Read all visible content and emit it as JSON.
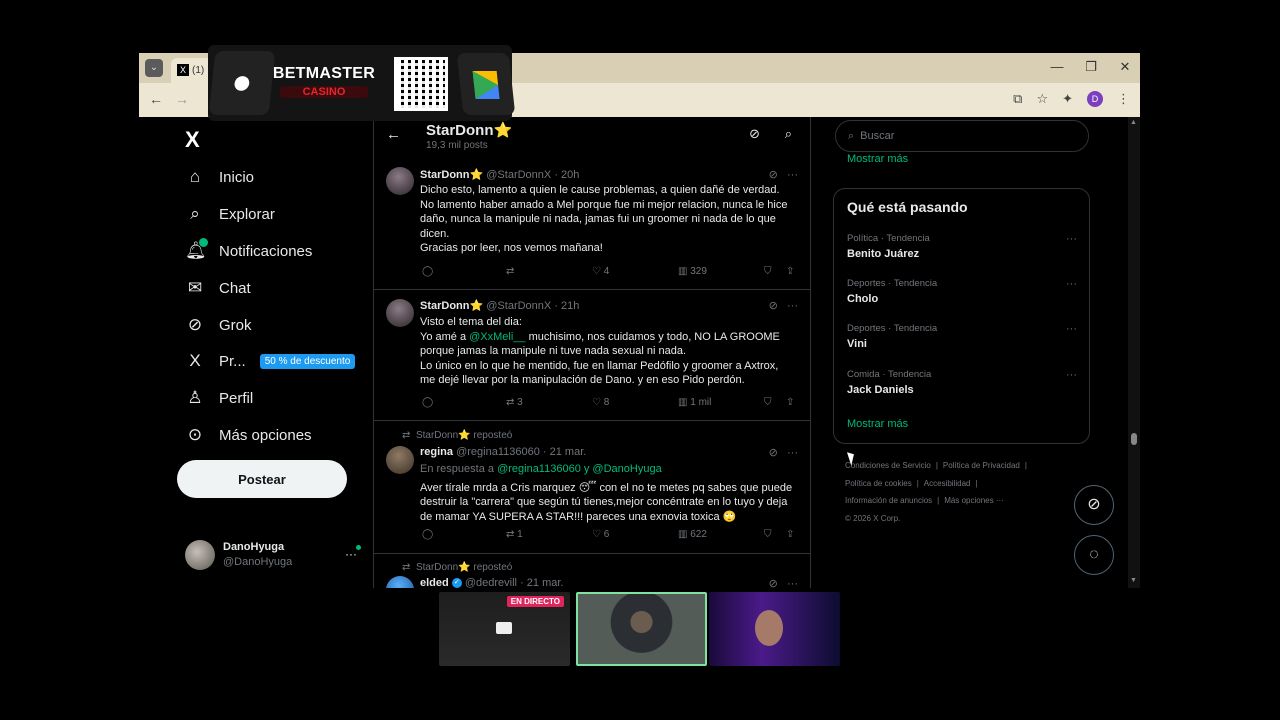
{
  "browser": {
    "tab_title": "(1)",
    "profile_initial": "D"
  },
  "sidebar": {
    "logo": "X",
    "items": [
      {
        "label": "Inicio",
        "icon": "home-icon"
      },
      {
        "label": "Explorar",
        "icon": "search-icon"
      },
      {
        "label": "Notificaciones",
        "icon": "bell-icon"
      },
      {
        "label": "Chat",
        "icon": "mail-icon"
      },
      {
        "label": "Grok",
        "icon": "grok-icon"
      },
      {
        "label": "Pr...",
        "icon": "x-premium-icon"
      },
      {
        "label": "Perfil",
        "icon": "person-icon"
      },
      {
        "label": "Más opciones",
        "icon": "more-circle-icon"
      }
    ],
    "premium_badge": "50 % de descuento",
    "post_button": "Postear",
    "account": {
      "name": "DanoHyuga",
      "handle": "@DanoHyuga"
    }
  },
  "profile_header": {
    "name": "StarDonn⭐",
    "posts": "19,3 mil posts"
  },
  "posts": [
    {
      "name": "StarDonn⭐",
      "handle": "@StarDonnX",
      "time": "· 20h",
      "text": [
        "Dicho esto, lamento a quien le cause problemas, a quien dañé de verdad.",
        "No lamento haber amado a Mel porque fue mi mejor relacion, nunca le hice",
        "daño, nunca la manipule ni nada, jamas fui un groomer ni nada de lo que",
        "dicen.",
        "Gracias por leer, nos vemos mañana!"
      ],
      "likes": "4",
      "views": "329"
    },
    {
      "name": "StarDonn⭐",
      "handle": "@StarDonnX",
      "time": "· 21h",
      "line1": "Visto el tema del dia:",
      "line2_pre": "Yo amé a ",
      "line2_mention": "@XxMeli__",
      "line2_post": " muchisimo, nos cuidamos y todo, NO LA GROOME",
      "text_rest": [
        "porque jamas la manipule ni tuve nada sexual ni nada.",
        "Lo único en lo que he mentido, fue en llamar Pedófilo y groomer a Axtrox,",
        "me dejé llevar por la manipulación de Dano. y en eso Pido perdón."
      ],
      "reposts": "3",
      "likes": "8",
      "views": "1 mil"
    },
    {
      "reposted_by": "StarDonn⭐ reposteó",
      "name": "regina",
      "handle": "@regina1136060",
      "time": "· 21 mar.",
      "reply_prefix": "En respuesta a ",
      "reply_mentions": "@regina1136060 y @DanoHyuga",
      "text": [
        "Aver tírale mrda a Cris marquez 😴 con el no te metes pq sabes que puede",
        "destruir la \"carrera\" que según tú tienes,mejor concéntrate en lo tuyo y deja",
        "de mamar YA SUPERA A STAR!!! pareces una exnovia toxica 🙄"
      ],
      "reposts": "1",
      "likes": "6",
      "views": "622"
    },
    {
      "reposted_by": "StarDonn⭐ reposteó",
      "name": "elded",
      "handle": "@dedrevill",
      "time": "· 21 mar."
    }
  ],
  "right": {
    "search_placeholder": "Buscar",
    "show_more_top": "Mostrar más",
    "trends_title": "Qué está pasando",
    "trends": [
      {
        "category": "Política · Tendencia",
        "name": "Benito Juárez"
      },
      {
        "category": "Deportes · Tendencia",
        "name": "Cholo"
      },
      {
        "category": "Deportes · Tendencia",
        "name": "Vini"
      },
      {
        "category": "Comida · Tendencia",
        "name": "Jack Daniels"
      }
    ],
    "show_more": "Mostrar más",
    "footer": {
      "terms": "Condiciones de Servicio",
      "privacy": "Política de Privacidad",
      "cookies": "Política de cookies",
      "accessibility": "Accesibilidad",
      "ads_info": "Información de anuncios",
      "more": "Más opciones ···",
      "copyright": "© 2026 X Corp."
    }
  },
  "ad": {
    "brand": "BETMASTER",
    "sub": "CASINO"
  },
  "stream": {
    "live_label": "EN DIRECTO"
  }
}
